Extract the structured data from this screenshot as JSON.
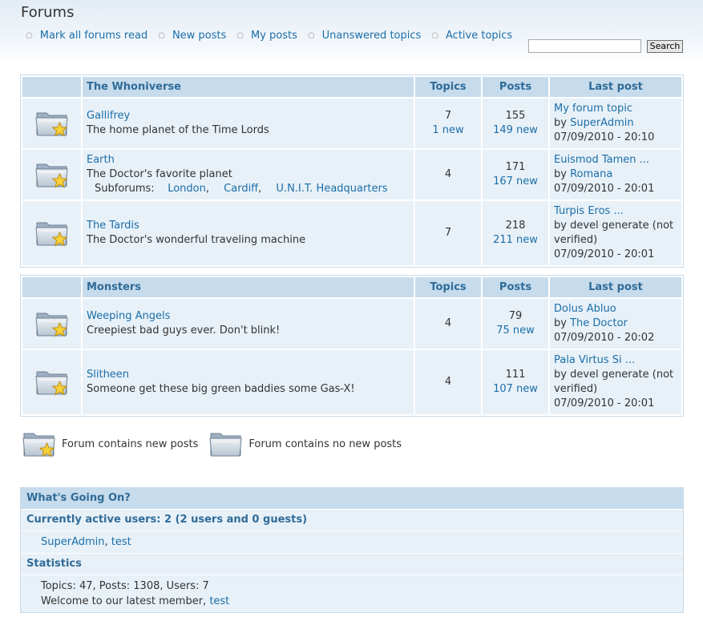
{
  "page_title": "Forums",
  "nav": [
    {
      "label": "Mark all forums read"
    },
    {
      "label": "New posts"
    },
    {
      "label": "My posts"
    },
    {
      "label": "Unanswered topics"
    },
    {
      "label": "Active topics"
    }
  ],
  "search": {
    "placeholder": "",
    "button_label": "Search"
  },
  "containers": [
    {
      "title": "The Whoniverse",
      "col_topics": "Topics",
      "col_posts": "Posts",
      "col_last": "Last post",
      "forums": [
        {
          "name": "Gallifrey",
          "description": "The home planet of the Time Lords",
          "topics": "7",
          "topics_new": "1 new",
          "posts": "155",
          "posts_new": "149 new",
          "last_title": "My forum topic",
          "last_by": "by ",
          "last_user": "SuperAdmin",
          "last_date": "07/09/2010 - 20:10"
        },
        {
          "name": "Earth",
          "description": "The Doctor's favorite planet",
          "subforums_label": "Subforums:",
          "subforums": [
            "London",
            "Cardiff",
            "U.N.I.T. Headquarters"
          ],
          "topics": "4",
          "posts": "171",
          "posts_new": "167 new",
          "last_title": "Euismod Tamen ...",
          "last_by": "by ",
          "last_user": "Romana",
          "last_date": "07/09/2010 - 20:01"
        },
        {
          "name": "The Tardis",
          "description": "The Doctor's wonderful traveling machine",
          "topics": "7",
          "posts": "218",
          "posts_new": "211 new",
          "last_title": "Turpis Eros ...",
          "last_by": "by devel generate (not verified)",
          "last_date": "07/09/2010 - 20:01"
        }
      ]
    },
    {
      "title": "Monsters",
      "col_topics": "Topics",
      "col_posts": "Posts",
      "col_last": "Last post",
      "forums": [
        {
          "name": "Weeping Angels",
          "description": "Creepiest bad guys ever. Don't blink!",
          "topics": "4",
          "posts": "79",
          "posts_new": "75 new",
          "last_title": "Dolus Abluo",
          "last_by": "by ",
          "last_user": "The Doctor",
          "last_date": "07/09/2010 - 20:02"
        },
        {
          "name": "Slitheen",
          "description": "Someone get these big green baddies some Gas-X!",
          "topics": "4",
          "posts": "111",
          "posts_new": "107 new",
          "last_title": "Pala Virtus Si ...",
          "last_by": "by devel generate (not verified)",
          "last_date": "07/09/2010 - 20:01"
        }
      ]
    }
  ],
  "legend": {
    "new": "Forum contains new posts",
    "none": "Forum contains no new posts"
  },
  "whats_going_on": {
    "title": "What's Going On?",
    "active_heading": "Currently active users: 2 (2 users and 0 guests)",
    "users": [
      "SuperAdmin",
      "test"
    ],
    "stats_heading": "Statistics",
    "stats_line": "Topics: 47, Posts: 1308, Users: 7",
    "welcome_prefix": "Welcome to our latest member, ",
    "latest_member": "test"
  },
  "colors": {
    "link": "#1b6ea8",
    "header_bg": "#c6dbeb",
    "row_bg": "#e8f1f8",
    "header_text": "#2f6b98"
  },
  "icons": {
    "forum_new": "folder-star-icon",
    "forum_none": "folder-icon"
  }
}
